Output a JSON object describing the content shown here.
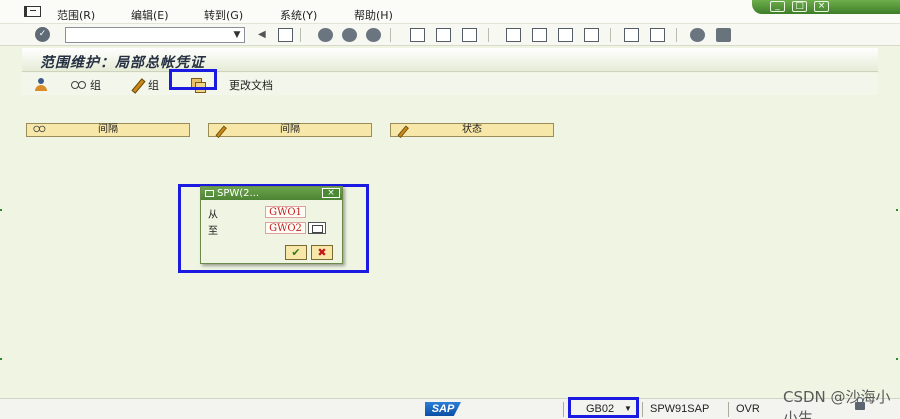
{
  "menu": {
    "items": [
      "范围(R)",
      "编辑(E)",
      "转到(G)",
      "系统(Y)",
      "帮助(H)"
    ]
  },
  "toolbar": {
    "command_value": ""
  },
  "screen": {
    "title": "范围维护：局部总帐凭证"
  },
  "app_toolbar": {
    "display_group_label": "组",
    "change_group_label": "组",
    "change_docs_label": "更改文档"
  },
  "segments": [
    "间隔",
    "间隔",
    "状态"
  ],
  "popup": {
    "title": "SPW(2...",
    "from_label": "从",
    "from_value": "GWO1",
    "to_label": "至",
    "to_value": "GWO2",
    "ok_symbol": "✔",
    "cancel_symbol": "✖"
  },
  "statusbar": {
    "logo": "SAP",
    "system": "GB02",
    "server": "SPW91SAP",
    "mode": "OVR",
    "watermark": "CSDN @沙海小小生"
  },
  "colors": {
    "accent_green": "#4d8434",
    "highlight_blue": "#1a1ae0",
    "segment_yellow": "#f7e7a8",
    "background": "#eff4e3"
  },
  "icons": {
    "display": "person-icon",
    "group_display": "glasses-icon",
    "group_change": "pencil-icon",
    "copy": "copy-icon"
  }
}
